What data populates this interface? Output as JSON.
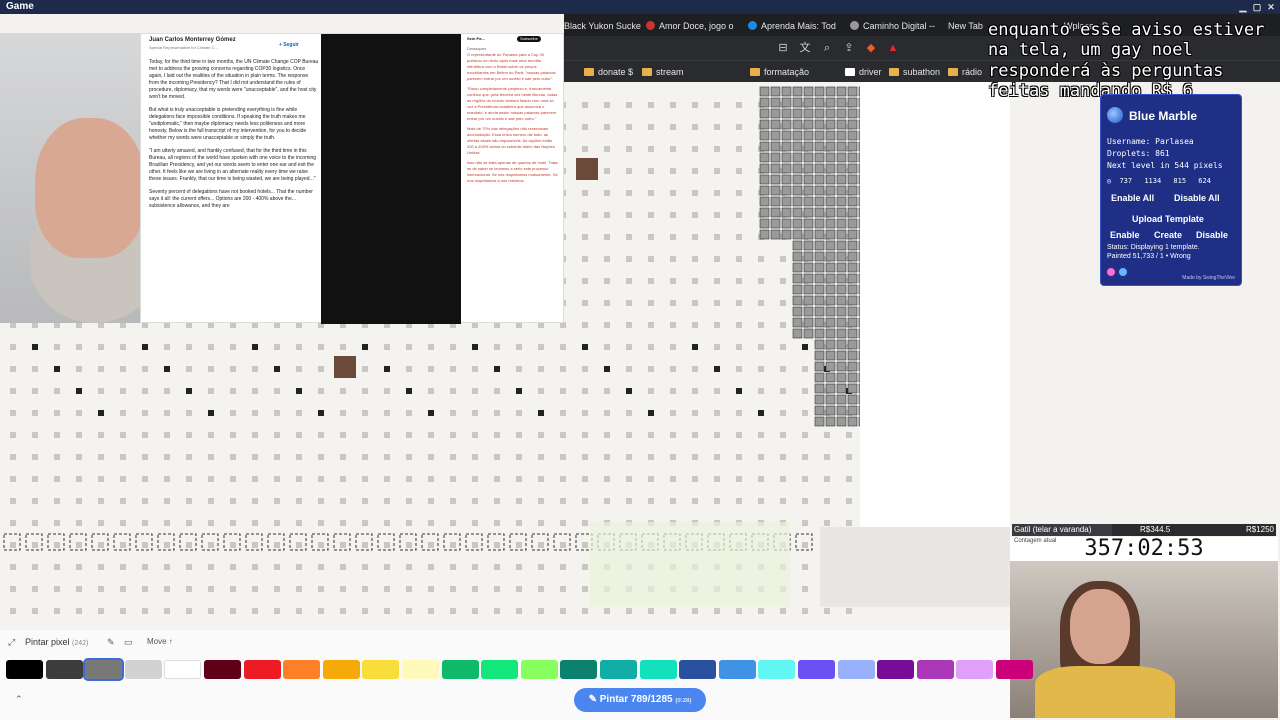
{
  "window": {
    "title": "Game"
  },
  "tabs": [
    {
      "label": "Black Yukon Sucke"
    },
    {
      "label": "Amor Doce, jogo o"
    },
    {
      "label": "Aprenda Mais: Tod"
    },
    {
      "label": "Caminho Digital --"
    },
    {
      "label": "New Tab"
    },
    {
      "label": "Wplace - P"
    }
  ],
  "bookmarks": [
    "donate $",
    "stream",
    "formatação",
    "driver",
    "subathon",
    "rádio"
  ],
  "overlay": {
    "text": "enquanto esse aviso estiver na tela, um gay noel responderá às perguntas feitas mandando R$ 6"
  },
  "blue_marble": {
    "title": "Blue Marble",
    "username": "Username: Parlasea",
    "droplets": "Droplets: 861",
    "next_level": "Next level in 544 pixels",
    "coords": [
      "737",
      "1134",
      "815",
      "624"
    ],
    "buttons": {
      "enable_all": "Enable All",
      "disable_all": "Disable All",
      "upload_template": "Upload Template",
      "enable": "Enable",
      "create": "Create",
      "disable": "Disable"
    },
    "status": "Status: Displaying 1 template.",
    "status2": "Painted 51,733 / 1 • Wrong",
    "footer": "Made by SwingTheVine"
  },
  "doc": {
    "author": "Juan Carlos Monterrey Gómez",
    "author_role": "Special Representative for Climate C...",
    "follow": "+ Seguir",
    "paragraph1": "Today, for the third time in two months, the UN Climate Change COP Bureau met to address the growing concerns regarding COP30 logistics. Once again, I laid out the realities of the situation in plain terms. The response from the incoming Presidency? That I did not understand the rules of procedure, diplomacy, that my words were \"unacceptable\", and the host city won't be moved.",
    "paragraph2": "But what is truly unacceptable is pretending everything is fine while delegations face impossible conditions. If speaking the truth makes me \"undiplomatic,\" then maybe diplomacy needs less politeness and more honesty. Below is the full transcript of my intervention, for you to decide whether my words were unacceptable or simply the truth.",
    "paragraph3": "\"I am utterly amazed, and frankly confused, that for the third time in this Bureau, all regions of the world have spoken with one voice to the incoming Brazilian Presidency, and yet our words seem to enter one ear and exit the other. It feels like we are living in an alternate reality every time we raise these issues. Frankly, that our time is being wasted, we are being played...\"",
    "paragraph4": "Seventy percent of delegations have not booked hotels... That the number says it all: the current offers... Options are 200 - 400% above the... subsistence allowance, and they are",
    "right_header": "Sem Pa...",
    "subscribe": "Subscribe",
    "right_tag": "Destaques",
    "right_text1": "O representante do Panamá para a Cop 30 publicou um texto após mais uma reunião infrutífera com o Brasil sobre os preços exorbitantes em Belém do Pará: \"nossas palavras parecem entrar por um ouvido e sair pelo outro\".",
    "right_text2": "\"Estou completamente perplexo e, francamente, confuso que, pela terceira vez neste Bureau, todas as regiões do mundo tenham falado com uma só voz à Presidência brasileira que assumirá o mandato, e ainda assim nossas palavras parecem entrar por um ouvido e sair pelo outro.\"",
    "right_text3": "Mais de 70% das delegações não reservaram acomodação. Essa única número diz tudo: as ofertas atuais são impossíveis. As opções estão 200 a 400% acima do subsídio diário das Nações Unidas.",
    "right_text4": "Isso não se trata apenas de quartos de hotel. Trata-se de saber se levamos a sério este processo internacional. Se nos respeitamos mutuamente. Se nos respeitamos a nós mesmos."
  },
  "stream": {
    "goal_label": "Gatil (telar a varanda)",
    "goal_value": "R$344.5",
    "goal_target": "R$1250",
    "timer_label": "Contagem atual",
    "timer": "357:02:53"
  },
  "paintbar": {
    "mode_label": "Pintar pixel",
    "mode_count": "(242)",
    "move_label": "Move",
    "paint_button": "Pintar 789/1285",
    "paint_timer": "(0:28)",
    "colors": [
      "#000000",
      "#3c3c3c",
      "#787878",
      "#d2d2d2",
      "#ffffff",
      "#600018",
      "#ed1c24",
      "#ff7f27",
      "#f6aa09",
      "#f9dd3b",
      "#fffabc",
      "#0eb968",
      "#13e67b",
      "#87ff5e",
      "#0c816e",
      "#10aea6",
      "#13e1be",
      "#28509e",
      "#4093e4",
      "#60f7f2",
      "#6b50f6",
      "#99b1fb",
      "#780c99",
      "#aa38b9",
      "#e09ff9",
      "#cb007a"
    ],
    "selected_index": 2
  }
}
